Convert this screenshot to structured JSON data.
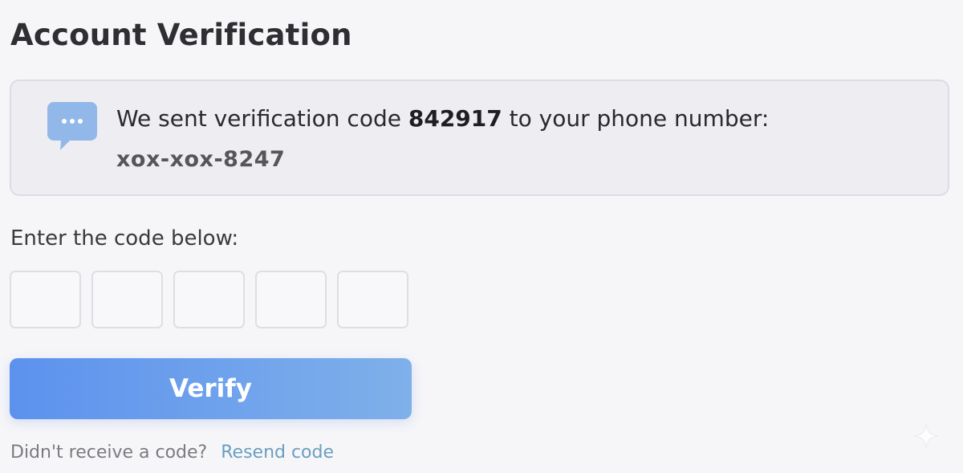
{
  "page": {
    "title": "Account Verification"
  },
  "info": {
    "icon": "chat-bubble-icon",
    "message_prefix": "We sent verification code ",
    "code": "842917",
    "message_suffix": " to your phone number:",
    "phone": "xox-xox-8247"
  },
  "form": {
    "prompt": "Enter the code below:",
    "digits": [
      "",
      "",
      "",
      "",
      ""
    ],
    "verify_label": "Verify"
  },
  "resend": {
    "question": "Didn't receive a code?",
    "link_label": "Resend code"
  },
  "colors": {
    "background": "#f6f6f9",
    "info_box": "#ededf2",
    "button_start": "#5c92ee",
    "button_end": "#7fb0ea",
    "link": "#6a9ec0",
    "icon": "#92b8ea"
  }
}
